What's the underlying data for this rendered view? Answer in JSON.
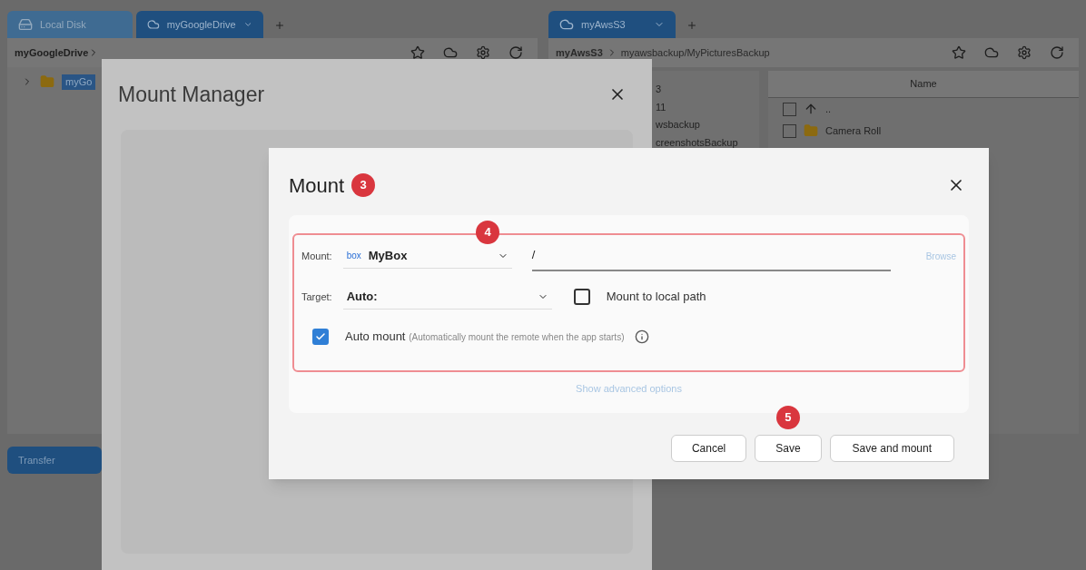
{
  "left_pane": {
    "tabs": [
      {
        "label": "Local Disk",
        "selected": false
      },
      {
        "label": "myGoogleDrive",
        "selected": true
      }
    ],
    "breadcrumb": "myGoogleDrive",
    "tree": [
      {
        "label": "myGo",
        "selected": true
      }
    ]
  },
  "right_pane": {
    "tabs": [
      {
        "label": "myAwsS3",
        "selected": true
      }
    ],
    "breadcrumb_remote": "myAwsS3",
    "breadcrumb_path": "myawsbackup/MyPicturesBackup",
    "tree_fragments": [
      "3",
      "11",
      "wsbackup",
      "creenshotsBackup"
    ],
    "files": {
      "column": "Name",
      "rows": [
        {
          "name": "..",
          "kind": "up",
          "checked": false
        },
        {
          "name": "Camera Roll",
          "kind": "folder",
          "checked": false
        }
      ]
    }
  },
  "transfer_tab": {
    "label": "Transfer",
    "selected": true
  },
  "mount_manager": {
    "title": "Mount Manager"
  },
  "mount_dialog": {
    "title": "Mount",
    "step": "3",
    "remote_step": "4",
    "mount_label": "Mount:",
    "remote_logo": "box",
    "remote_name": "MyBox",
    "path": "/",
    "browse": "Browse",
    "target_label": "Target:",
    "target": "Auto:",
    "local_path": {
      "label": "Mount to local path",
      "checked": false
    },
    "auto_mount": {
      "label": "Auto mount",
      "hint": "(Automatically mount the remote when the app starts)",
      "checked": true
    },
    "advanced": "Show advanced options",
    "buttons": [
      {
        "label": "Cancel"
      },
      {
        "label": "Save",
        "step": "5"
      },
      {
        "label": "Save and mount"
      }
    ]
  }
}
